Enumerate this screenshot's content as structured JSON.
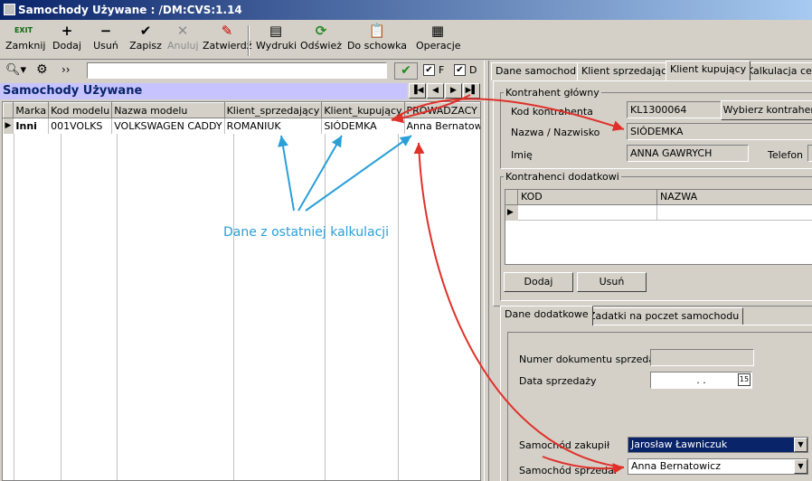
{
  "window": {
    "title": "Samochody Używane : /DM:CVS:1.14"
  },
  "toolbar": [
    {
      "label": "Zamknij",
      "icon": "exit-icon",
      "glyph": "EXIT",
      "disabled": false
    },
    {
      "label": "Dodaj",
      "icon": "plus-icon",
      "glyph": "+",
      "disabled": false
    },
    {
      "label": "Usuń",
      "icon": "minus-icon",
      "glyph": "−",
      "disabled": false
    },
    {
      "label": "Zapisz",
      "icon": "checkmark-icon",
      "glyph": "✔",
      "disabled": false
    },
    {
      "label": "Anuluj",
      "icon": "cross-icon",
      "glyph": "✕",
      "disabled": true
    },
    {
      "label": "Zatwierdź",
      "icon": "pen-icon",
      "glyph": "✎",
      "disabled": false
    },
    {
      "label": "Wydruki",
      "icon": "print-icon",
      "glyph": "▤",
      "disabled": false
    },
    {
      "label": "Odśwież",
      "icon": "refresh-icon",
      "glyph": "⟳",
      "disabled": false
    },
    {
      "label": "Do schowka",
      "icon": "clipboard-icon",
      "glyph": "📋",
      "disabled": false
    },
    {
      "label": "Operacje",
      "icon": "calculator-icon",
      "glyph": "▦",
      "disabled": false
    }
  ],
  "filter": {
    "search_value": "",
    "more_label": "››",
    "check_f_label": "F",
    "check_d_label": "D",
    "check_f": true,
    "check_d": true
  },
  "section": {
    "title": "Samochody Używane"
  },
  "grid": {
    "columns": [
      "Marka",
      "Kod modelu",
      "Nazwa modelu",
      "Klient_sprzedający",
      "Klient_kupujący",
      "PROWADZACY"
    ],
    "rows": [
      {
        "marka": "Inni",
        "kod": "001VOLKS",
        "nazwa": "VOLKSWAGEN CADDY",
        "sprzedajacy": "ROMANIUK",
        "kupujacy": "SIÓDEMKA",
        "prowadzacy": "Anna Bernatowicz"
      }
    ]
  },
  "tabs_top": [
    "Dane samochodu",
    "Klient sprzedający",
    "Klient kupujący",
    "Kalkulacja ceny"
  ],
  "tabs_top_active": 2,
  "kontrahent": {
    "group_label": "Kontrahent główny",
    "kod_label": "Kod kontrahenta",
    "kod_value": "KL1300064",
    "wybierz_label": "Wybierz kontrahenta",
    "nazwa_label": "Nazwa / Nazwisko",
    "nazwa_value": "SIÓDEMKA",
    "imie_label": "Imię",
    "imie_value": "ANNA GAWRYCH",
    "telefon_label": "Telefon",
    "telefon_value": ""
  },
  "dodatkowi": {
    "group_label": "Kontrahenci dodatkowi",
    "columns": [
      "KOD",
      "NAZWA"
    ],
    "dodaj_label": "Dodaj",
    "usun_label": "Usuń"
  },
  "tabs_bottom": [
    "Dane dodatkowe",
    "Zadatki na poczet samochodu"
  ],
  "tabs_bottom_active": 0,
  "dodatkowe": {
    "numer_label": "Numer dokumentu sprzedaży",
    "numer_value": "",
    "data_label": "Data sprzedaży",
    "data_value": " .  . ",
    "cal_label": "15",
    "zakupil_label": "Samochód zakupił",
    "zakupil_value": "Jarosław Ławniczuk",
    "sprzedal_label": "Samochód sprzedał",
    "sprzedal_value": "Anna Bernatowicz"
  },
  "annotation": {
    "text": "Dane z ostatniej kalkulacji",
    "color_text": "#2a9fd8",
    "color_blue_arrows": "#2a9fd8",
    "color_red_arrows": "#e0302a"
  }
}
